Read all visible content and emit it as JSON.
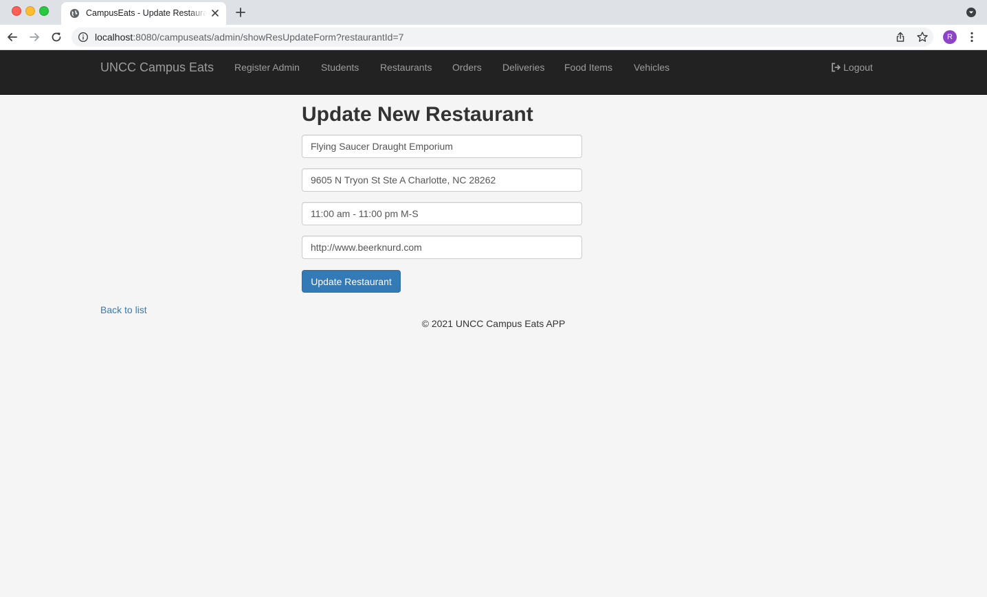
{
  "browser": {
    "tab_title": "CampusEats - Update Restaurant",
    "url_host": "localhost",
    "url_path": ":8080/campuseats/admin/showResUpdateForm?restaurantId=7",
    "profile_initial": "R"
  },
  "navbar": {
    "brand": "UNCC Campus Eats",
    "links": [
      "Register Admin",
      "Students",
      "Restaurants",
      "Orders",
      "Deliveries",
      "Food Items",
      "Vehicles"
    ],
    "logout": "Logout"
  },
  "form": {
    "title": "Update New Restaurant",
    "name": "Flying Saucer Draught Emporium",
    "address": "9605 N Tryon St Ste A Charlotte, NC 28262",
    "hours": "11:00 am - 11:00 pm M-S",
    "website": "http://www.beerknurd.com",
    "submit_label": "Update Restaurant"
  },
  "back_link": "Back to list",
  "footer": "© 2021 UNCC Campus Eats APP",
  "colors": {
    "navbar_bg": "#222222",
    "navbar_text": "#9d9d9d",
    "primary": "#337ab7",
    "page_bg": "#f5f5f5",
    "avatar": "#8e44c9"
  }
}
